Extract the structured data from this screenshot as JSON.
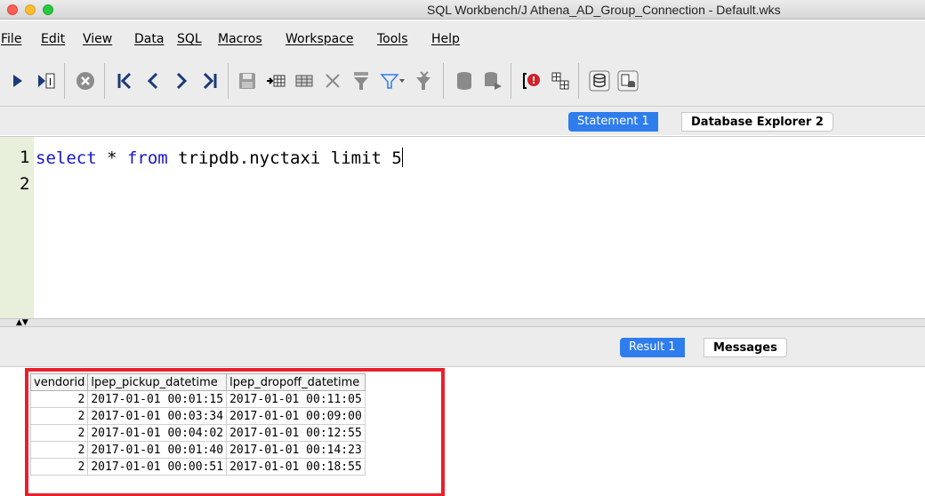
{
  "window": {
    "title": "SQL Workbench/J Athena_AD_Group_Connection - Default.wks"
  },
  "menu": {
    "items": [
      "File",
      "Edit",
      "View",
      "Data",
      "SQL",
      "Macros",
      "Workspace",
      "Tools",
      "Help"
    ]
  },
  "toolbar": {
    "icons": [
      "execute-icon",
      "execute-current-icon",
      "cancel-icon",
      "first-page-icon",
      "previous-icon",
      "next-icon",
      "last-page-icon",
      "save-icon",
      "insert-row-icon",
      "copy-row-icon",
      "delete-icon",
      "filter-icon",
      "filter-dropdown-icon",
      "clear-filter-icon",
      "database-icon",
      "database-export-icon",
      "error-icon",
      "grid-icon",
      "db-explorer-icon",
      "settings-icon"
    ]
  },
  "editor_tabs": [
    {
      "label": "Statement 1",
      "active": true
    },
    {
      "label": "Database Explorer 2",
      "active": false
    }
  ],
  "editor": {
    "line_numbers": [
      "1",
      "2"
    ],
    "code": {
      "kw1": "select",
      "plain1": " * ",
      "kw2": "from",
      "plain2": " tripdb.nyctaxi limit 5"
    }
  },
  "result_tabs": [
    {
      "label": "Result 1",
      "active": true
    },
    {
      "label": "Messages",
      "active": false
    }
  ],
  "result": {
    "columns": [
      "vendorid",
      "lpep_pickup_datetime",
      "lpep_dropoff_datetime"
    ],
    "rows": [
      [
        "2",
        "2017-01-01 00:01:15",
        "2017-01-01 00:11:05"
      ],
      [
        "2",
        "2017-01-01 00:03:34",
        "2017-01-01 00:09:00"
      ],
      [
        "2",
        "2017-01-01 00:04:02",
        "2017-01-01 00:12:55"
      ],
      [
        "2",
        "2017-01-01 00:01:40",
        "2017-01-01 00:14:23"
      ],
      [
        "2",
        "2017-01-01 00:00:51",
        "2017-01-01 00:18:55"
      ]
    ]
  },
  "colors": {
    "accent": "#2f7ded",
    "keyword": "#1717c8",
    "highlight_frame": "#e8202c",
    "gutter": "#e8efdb"
  }
}
